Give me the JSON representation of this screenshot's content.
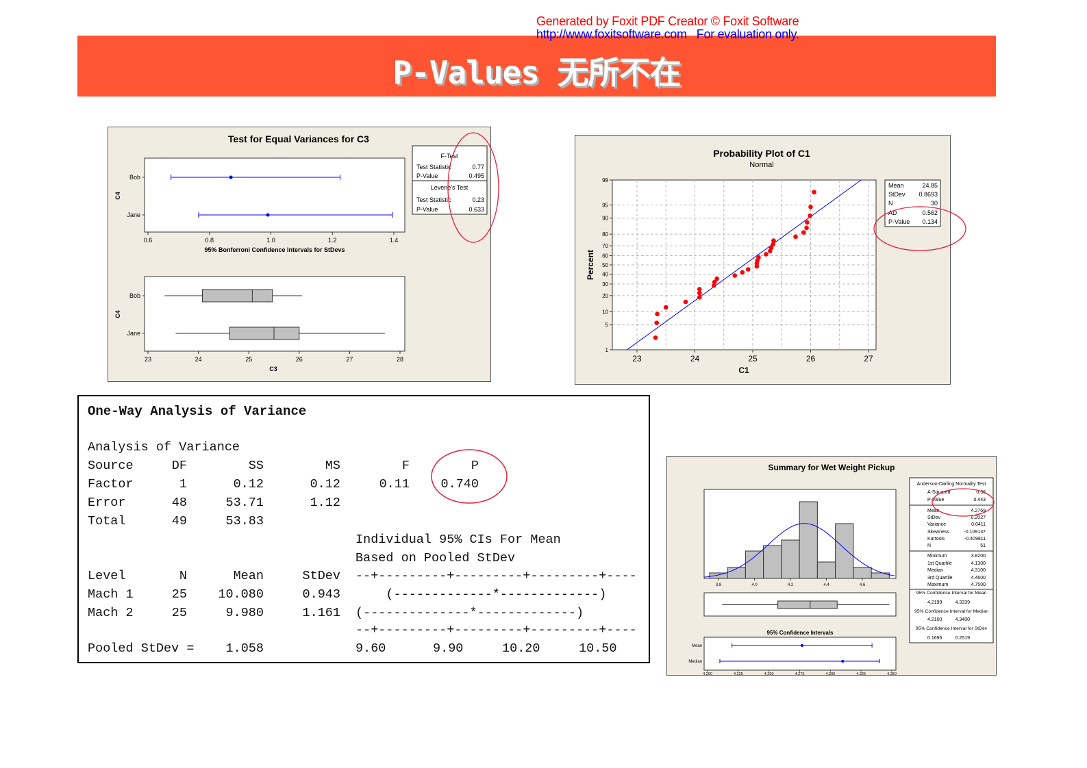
{
  "watermark": {
    "line1": "Generated by Foxit PDF Creator © Foxit Software",
    "line2a": "http://www.foxitsoftware.com",
    "line2b": "For evaluation only."
  },
  "header": {
    "title": "P-Values 无所不在"
  },
  "colors": {
    "header_bg": "#FF5533",
    "highlight_circle": "#E8203A",
    "ci_blue": "#0000FF",
    "points_red": "#FF0000",
    "panel_bg": "#F0ECE2",
    "bar_gray": "#C0C0C0"
  },
  "chart_data": [
    {
      "type": "interval+boxplot",
      "title": "Test for Equal Variances for C3",
      "ci": {
        "ylabel": "C4",
        "xlabel": "95% Bonferroni Confidence Intervals for StDevs",
        "xlim": [
          0.6,
          1.4
        ],
        "xticks": [
          "0.6",
          "0.8",
          "1.0",
          "1.2",
          "1.4"
        ],
        "groups": [
          {
            "name": "Bob",
            "low": 0.675,
            "est": 0.87,
            "high": 1.225
          },
          {
            "name": "Jane",
            "low": 0.765,
            "est": 0.99,
            "high": 1.395
          }
        ]
      },
      "boxplot": {
        "ylabel": "C4",
        "xlabel": "C3",
        "xlim": [
          23,
          28
        ],
        "xticks": [
          "23",
          "24",
          "25",
          "26",
          "27",
          "28"
        ],
        "groups": [
          {
            "name": "Bob",
            "min": 23.33,
            "q1": 24.08,
            "median": 25.07,
            "q3": 25.47,
            "max": 26.06
          },
          {
            "name": "Jane",
            "min": 23.55,
            "q1": 24.62,
            "median": 25.5,
            "q3": 26.0,
            "max": 27.7
          }
        ]
      },
      "stats": {
        "ftest": {
          "title": "F-Test",
          "rows": [
            [
              "Test Statistic",
              "0.77"
            ],
            [
              "P-Value",
              "0.495"
            ]
          ]
        },
        "levene": {
          "title": "Levene's Test",
          "rows": [
            [
              "Test Statistic",
              "0.23"
            ],
            [
              "P-Value",
              "0.633"
            ]
          ]
        }
      },
      "highlighted": "P-Value"
    },
    {
      "type": "scatter",
      "title": "Probability Plot of C1",
      "subtitle": "Normal",
      "xlabel": "C1",
      "ylabel": "Percent",
      "xlim": [
        22.6,
        27.1
      ],
      "xticks": [
        "23",
        "24",
        "25",
        "26",
        "27"
      ],
      "yscale": "normal-probability",
      "ylim": [
        1,
        99
      ],
      "yticks": [
        "1",
        "5",
        "10",
        "20",
        "30",
        "40",
        "50",
        "60",
        "70",
        "80",
        "90",
        "95",
        "99"
      ],
      "grid": true,
      "fit_line": {
        "mean": 24.85,
        "stdev": 0.8693
      },
      "points": {
        "x": [
          23.32,
          23.34,
          23.35,
          23.5,
          23.84,
          24.08,
          24.08,
          24.08,
          24.33,
          24.34,
          24.38,
          24.69,
          24.82,
          24.92,
          25.07,
          25.07,
          25.08,
          25.1,
          25.23,
          25.3,
          25.32,
          25.35,
          25.36,
          25.74,
          25.88,
          25.93,
          25.94,
          25.99,
          26.0,
          26.06
        ],
        "y": [
          2.3,
          5.6,
          8.9,
          12.2,
          15.5,
          18.8,
          22.0,
          25.3,
          28.6,
          31.9,
          35.2,
          38.5,
          41.8,
          45.1,
          48.4,
          51.6,
          54.9,
          58.2,
          61.5,
          64.8,
          68.1,
          71.4,
          74.7,
          78.0,
          81.3,
          84.5,
          87.8,
          91.1,
          94.4,
          97.7
        ]
      },
      "stats": [
        [
          "Mean",
          "24.85"
        ],
        [
          "StDev",
          "0.8693"
        ],
        [
          "N",
          "30"
        ],
        [
          "AD",
          "0.562"
        ],
        [
          "P-Value",
          "0.134"
        ]
      ],
      "highlighted": "P-Value"
    },
    {
      "type": "bar",
      "title": "Summary for Wet Weight Pickup",
      "histogram": {
        "bin_centers": [
          3.8,
          3.9,
          4.0,
          4.1,
          4.2,
          4.3,
          4.4,
          4.5,
          4.6,
          4.7
        ],
        "counts": [
          1,
          2,
          5,
          6,
          7,
          14,
          3,
          10,
          2,
          1
        ],
        "bin_width": 0.1,
        "xlim": [
          3.72,
          4.787
        ],
        "xticks": [
          "3.8",
          "4.0",
          "4.2",
          "4.4",
          "4.6"
        ],
        "normal_curve": {
          "mean": 4.2769,
          "stdev": 0.2027,
          "n": 51
        }
      },
      "boxplot": {
        "min": 3.82,
        "q1": 4.13,
        "median": 4.31,
        "q3": 4.46,
        "max": 4.75
      },
      "ci": {
        "title": "95% Confidence Intervals",
        "xlim": [
          4.2,
          4.35
        ],
        "xticks": [
          "4.200",
          "4.225",
          "4.250",
          "4.275",
          "4.300",
          "4.325",
          "4.350"
        ],
        "groups": [
          {
            "name": "Mean",
            "low": 4.2199,
            "est": 4.2769,
            "high": 4.3339
          },
          {
            "name": "Median",
            "low": 4.21,
            "est": 4.31,
            "high": 4.34
          }
        ]
      },
      "stats": {
        "ad_title": "Anderson-Darling Normality Test",
        "ad_rows": [
          [
            "A-Squared",
            "0.36"
          ],
          [
            "P-Value",
            "0.443"
          ]
        ],
        "moments": [
          [
            "Mean",
            "4.2769"
          ],
          [
            "StDev",
            "0.2027"
          ],
          [
            "Variance",
            "0.0411"
          ],
          [
            "Skewness",
            "-0.109137"
          ],
          [
            "Kurtosis",
            "-0.409811"
          ],
          [
            "N",
            "51"
          ]
        ],
        "quantiles": [
          [
            "Minimum",
            "3.8200"
          ],
          [
            "1st Quartile",
            "4.1300"
          ],
          [
            "Median",
            "4.3100"
          ],
          [
            "3rd Quartile",
            "4.4600"
          ],
          [
            "Maximum",
            "4.7500"
          ]
        ],
        "intervals": [
          {
            "title": "95% Confidence Interval for Mean",
            "low": "4.2199",
            "high": "4.3339"
          },
          {
            "title": "95% Confidence Interval for Median",
            "low": "4.2100",
            "high": "4.3400"
          },
          {
            "title": "95% Confidence Interval for StDev",
            "low": "0.1696",
            "high": "0.2519"
          }
        ]
      },
      "highlighted": "P-Value"
    }
  ],
  "anova": {
    "title": "One-Way Analysis of Variance",
    "subtitle": "Analysis of Variance",
    "headers": [
      "Source",
      "DF",
      "SS",
      "MS",
      "F",
      "P"
    ],
    "rows": [
      [
        "Factor",
        "1",
        "0.12",
        "0.12",
        "0.11",
        "0.740"
      ],
      [
        "Error",
        "48",
        "53.71",
        "1.12",
        "",
        ""
      ],
      [
        "Total",
        "49",
        "53.83",
        "",
        "",
        ""
      ]
    ],
    "ci_caption1": "Individual 95% CIs For Mean",
    "ci_caption2": "Based on Pooled StDev",
    "level_headers": [
      "Level",
      "N",
      "Mean",
      "StDev"
    ],
    "levels": [
      [
        "Mach 1",
        "25",
        "10.080",
        "0.943"
      ],
      [
        "Mach 2",
        "25",
        "9.980",
        "1.161"
      ]
    ],
    "ci_ruler": "--+---------+---------+---------+----",
    "ci_lines": [
      "    (-------------*-------------)",
      "(--------------*-------------)"
    ],
    "ci_ticks": [
      "9.60",
      "9.90",
      "10.20",
      "10.50"
    ],
    "pooled_label": "Pooled StDev =",
    "pooled_value": "1.058",
    "highlighted": "P"
  }
}
